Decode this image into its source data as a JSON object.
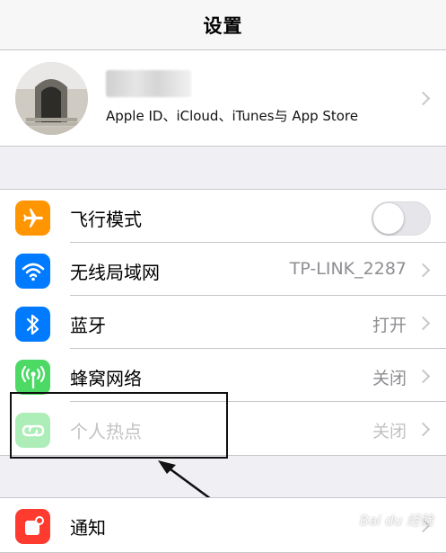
{
  "header": {
    "title": "设置"
  },
  "profile": {
    "subtitle": "Apple ID、iCloud、iTunes与 App Store"
  },
  "rows": [
    {
      "label": "飞行模式",
      "icon": "airplane-icon",
      "color": "#ff9500",
      "toggle": false
    },
    {
      "label": "无线局域网",
      "value": "TP-LINK_2287",
      "icon": "wifi-icon",
      "color": "#007aff"
    },
    {
      "label": "蓝牙",
      "value": "打开",
      "icon": "bluetooth-icon",
      "color": "#007aff"
    },
    {
      "label": "蜂窝网络",
      "value": "关闭",
      "icon": "cellular-icon",
      "color": "#4cd964"
    },
    {
      "label": "个人热点",
      "value": "关闭",
      "icon": "hotspot-icon",
      "color": "#4cd964",
      "disabled": true
    }
  ],
  "notifications": {
    "label": "通知",
    "icon": "notification-icon",
    "color": "#ff3b30"
  },
  "watermark": "Bai du 经验"
}
